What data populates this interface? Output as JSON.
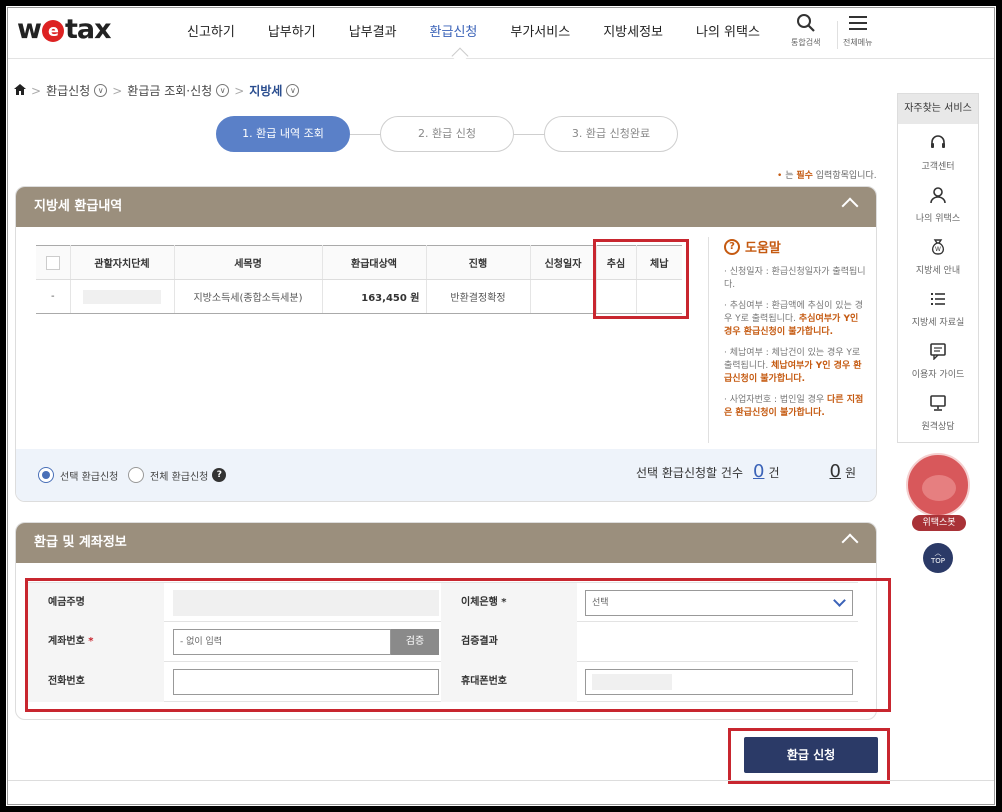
{
  "header": {
    "logo": "wetax",
    "nav": [
      "신고하기",
      "납부하기",
      "납부결과",
      "환급신청",
      "부가서비스",
      "지방세정보",
      "나의 위택스"
    ],
    "active_nav": "환급신청",
    "search_label": "통합검색",
    "menu_label": "전체메뉴"
  },
  "breadcrumb": {
    "items": [
      "환급신청",
      "환급금 조회·신청",
      "지방세"
    ]
  },
  "steps": [
    "1. 환급 내역 조회",
    "2. 환급 신청",
    "3. 환급 신청완료"
  ],
  "required_note": {
    "prefix": "•",
    "text_before": "는 ",
    "bold": "필수",
    "text_after": " 입력항목입니다."
  },
  "refund_panel": {
    "title": "지방세 환급내역",
    "columns": [
      "",
      "관할자치단체",
      "세목명",
      "환급대상액",
      "진행",
      "신청일자",
      "추심",
      "체납"
    ],
    "rows": [
      {
        "check": "-",
        "authority": "",
        "tax_item": "지방소득세(종합소득세분)",
        "amount": "163,450 원",
        "status": "반환결정확정",
        "date": "",
        "collection": "",
        "arrears": ""
      }
    ],
    "help": {
      "title": "도움말",
      "items": [
        {
          "text": "신청일자 : 환급신청일자가 출력됩니다.",
          "warn": ""
        },
        {
          "text": "추심여부 : 환급액에 추심이 있는 경우 Y로 출력됩니다.",
          "warn": "추심여부가 Y인 경우 환급신청이 불가합니다."
        },
        {
          "text": "체납여부 : 체납건이 있는 경우 Y로 출력됩니다.",
          "warn": "체납여부가 Y인 경우 환급신청이 불가합니다."
        },
        {
          "text": "사업자번호 : 법인일 경우",
          "warn": "다른 지점은 환급신청이 불가합니다."
        }
      ]
    },
    "radio_selected": "선택 환급신청",
    "radio_all": "전체 환급신청",
    "count_label": "선택 환급신청할 건수",
    "count_value": "0",
    "count_unit": "건",
    "amount_value": "0",
    "amount_unit": "원"
  },
  "account_panel": {
    "title": "환급 및 계좌정보",
    "depositor_label": "예금주명",
    "bank_label": "이체은행",
    "bank_value": "선택",
    "account_label": "계좌번호",
    "account_placeholder": "- 없이 입력",
    "verify_button": "검증",
    "verify_result_label": "검증결과",
    "phone_label": "전화번호",
    "mobile_label": "휴대폰번호",
    "required_mark": "*"
  },
  "submit_button": "환급 신청",
  "quick_menu": {
    "title": "자주찾는 서비스",
    "items": [
      {
        "label": "고객센터",
        "icon": "headset-icon"
      },
      {
        "label": "나의 위택스",
        "icon": "person-icon"
      },
      {
        "label": "지방세 안내",
        "icon": "money-bag-icon"
      },
      {
        "label": "지방세 자료실",
        "icon": "list-icon"
      },
      {
        "label": "이용자 가이드",
        "icon": "chat-icon"
      },
      {
        "label": "원격상담",
        "icon": "monitor-icon"
      }
    ],
    "bot_label": "위택스봇",
    "top_label": "TOP"
  },
  "colors": {
    "panel_header": "#9b8f7d",
    "accent_blue": "#5a80c8",
    "submit": "#2b3a67",
    "highlight_red": "#c8262f",
    "warn_orange": "#c55a11"
  }
}
